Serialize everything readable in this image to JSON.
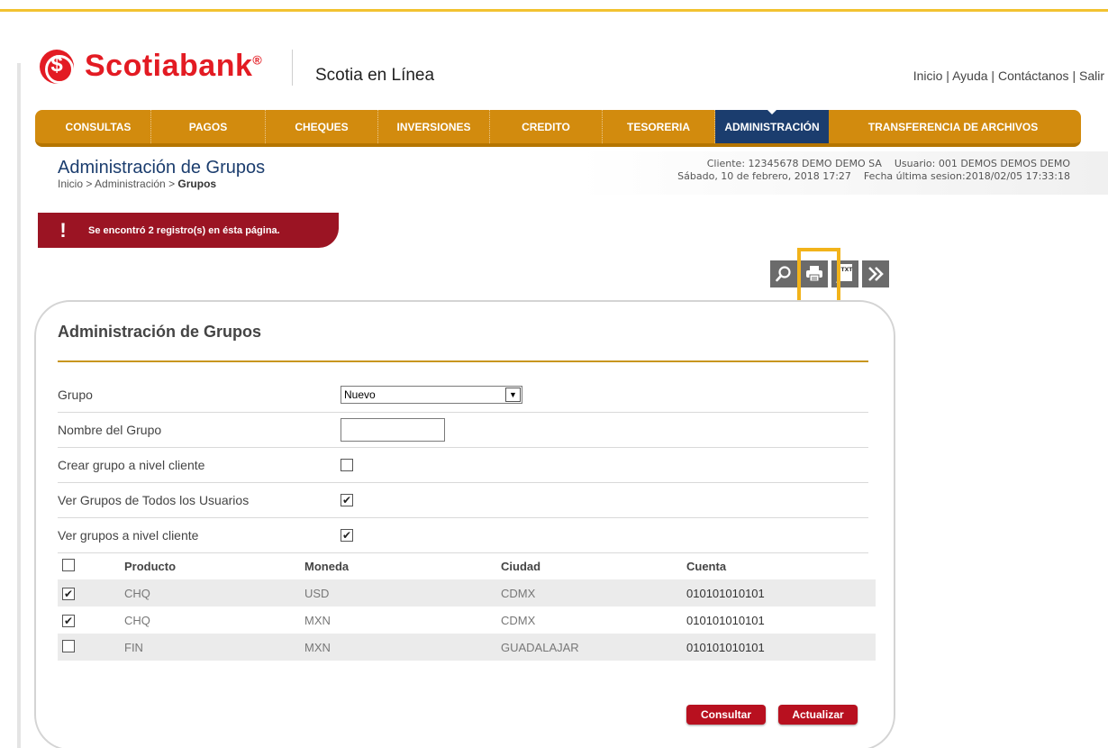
{
  "header": {
    "brand": "Scotiabank",
    "brand_mark": "®",
    "product": "Scotia en Línea",
    "links": [
      "Inicio",
      "Ayuda",
      "Contáctanos",
      "Salir"
    ]
  },
  "nav": {
    "tabs": [
      {
        "label": "CONSULTAS"
      },
      {
        "label": "PAGOS"
      },
      {
        "label": "CHEQUES"
      },
      {
        "label": "INVERSIONES"
      },
      {
        "label": "CREDITO"
      },
      {
        "label": "TESORERIA"
      },
      {
        "label": "ADMINISTRACIÓN"
      },
      {
        "label": "TRANSFERENCIA DE ARCHIVOS"
      }
    ],
    "active": "ADMINISTRACIÓN"
  },
  "page": {
    "title": "Administración de Grupos",
    "breadcrumb": [
      "Inicio",
      "Administración",
      "Grupos"
    ],
    "client_line": "Cliente: 12345678 DEMO DEMO SA    Usuario: 001 DEMOS DEMOS DEMO",
    "date_line": "Sábado, 10 de febrero, 2018 17:27    Fecha última sesion:2018/02/05 17:33:18"
  },
  "alert": {
    "message": "Se encontró 2 registro(s) en ésta página."
  },
  "toolbar": {
    "icons": [
      "search-icon",
      "print-icon",
      "txt-export-icon",
      "next-icon"
    ],
    "highlighted": "print-icon"
  },
  "form": {
    "title": "Administración de Grupos",
    "grupo_label": "Grupo",
    "grupo_value": "Nuevo",
    "nombre_label": "Nombre del Grupo",
    "nombre_value": "",
    "crear_label": "Crear grupo a nivel cliente",
    "crear_checked": false,
    "ver_todos_label": "Ver Grupos de Todos los Usuarios",
    "ver_todos_checked": true,
    "ver_cliente_label": "Ver grupos a nivel cliente",
    "ver_cliente_checked": true
  },
  "table": {
    "headers": [
      "Producto",
      "Moneda",
      "Ciudad",
      "Cuenta"
    ],
    "select_all_checked": false,
    "rows": [
      {
        "checked": true,
        "producto": "CHQ",
        "moneda": "USD",
        "ciudad": "CDMX",
        "cuenta": "010101010101"
      },
      {
        "checked": true,
        "producto": "CHQ",
        "moneda": "MXN",
        "ciudad": "CDMX",
        "cuenta": "010101010101"
      },
      {
        "checked": false,
        "producto": "FIN",
        "moneda": "MXN",
        "ciudad": "GUADALAJAR",
        "cuenta": "010101010101"
      }
    ]
  },
  "actions": {
    "consultar": "Consultar",
    "actualizar": "Actualizar"
  },
  "colors": {
    "brand_red": "#e31b23",
    "nav_gold": "#d28b0e",
    "nav_active": "#1b3d6e",
    "alert_red": "#9b1423",
    "button_red": "#b8101f",
    "highlight": "#f2b31a"
  }
}
